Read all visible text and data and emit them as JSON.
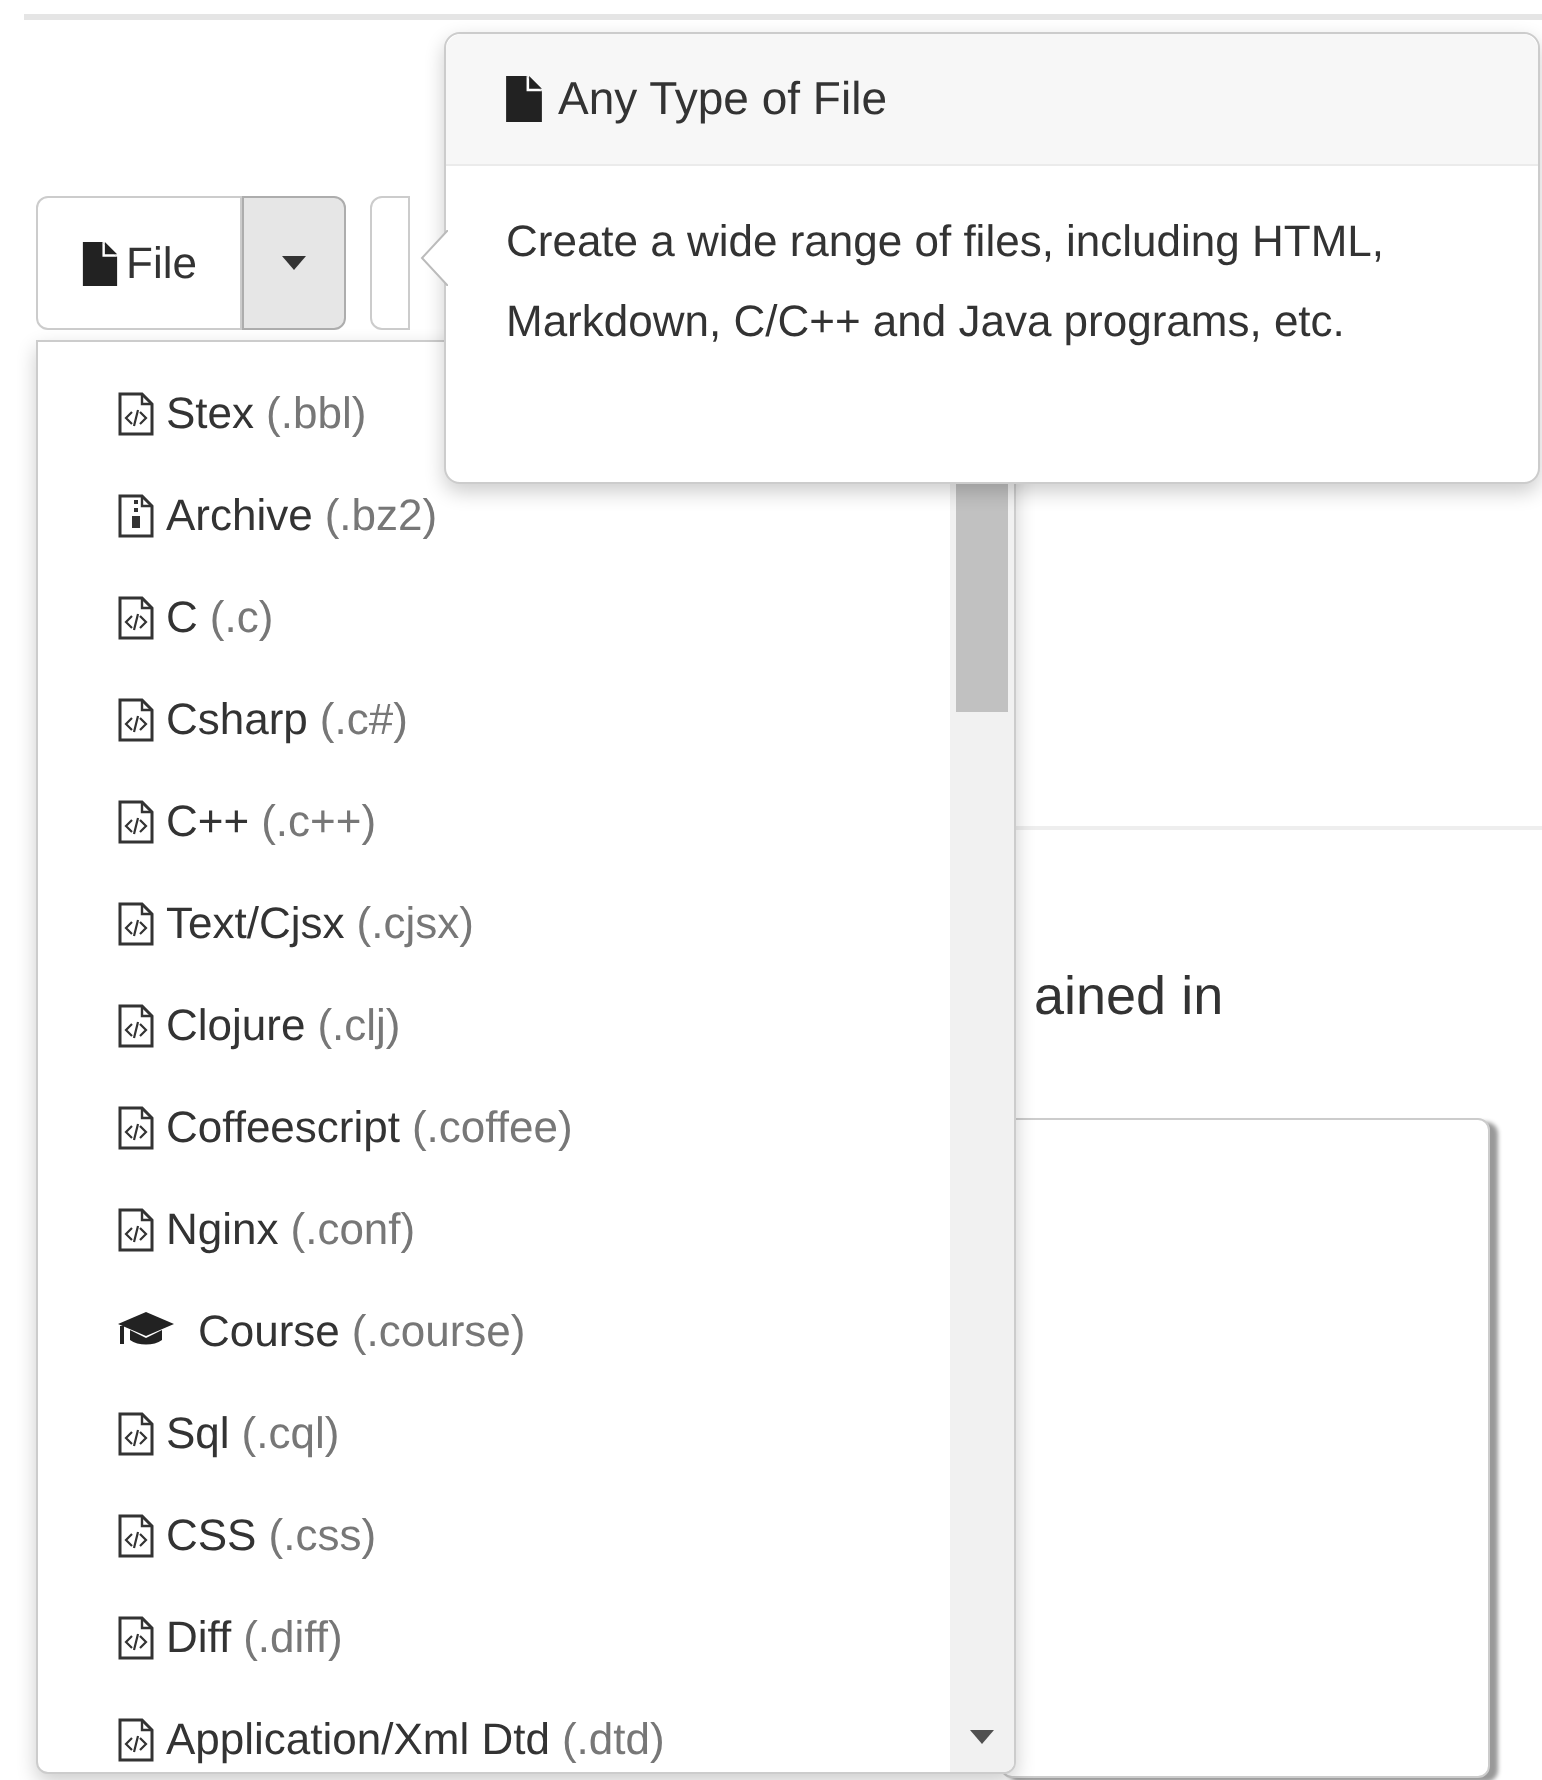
{
  "file_button": {
    "label": "File"
  },
  "popover": {
    "title": "Any Type of File",
    "body": "Create a wide range of files, including HTML, Markdown, C/C++ and Java programs, etc."
  },
  "background_text": "ained in",
  "menu": {
    "items": [
      {
        "kind": "code",
        "name": "Stex",
        "extension": "(.bbl)"
      },
      {
        "kind": "archive",
        "name": "Archive",
        "extension": "(.bz2)"
      },
      {
        "kind": "code",
        "name": "C",
        "extension": "(.c)"
      },
      {
        "kind": "code",
        "name": "Csharp",
        "extension": "(.c#)"
      },
      {
        "kind": "code",
        "name": "C++",
        "extension": "(.c++)"
      },
      {
        "kind": "code",
        "name": "Text/Cjsx",
        "extension": "(.cjsx)"
      },
      {
        "kind": "code",
        "name": "Clojure",
        "extension": "(.clj)"
      },
      {
        "kind": "code",
        "name": "Coffeescript",
        "extension": "(.coffee)"
      },
      {
        "kind": "code",
        "name": "Nginx",
        "extension": "(.conf)"
      },
      {
        "kind": "course",
        "name": "Course",
        "extension": "(.course)"
      },
      {
        "kind": "code",
        "name": "Sql",
        "extension": "(.cql)"
      },
      {
        "kind": "code",
        "name": "CSS",
        "extension": "(.css)"
      },
      {
        "kind": "code",
        "name": "Diff",
        "extension": "(.diff)"
      },
      {
        "kind": "code",
        "name": "Application/Xml Dtd",
        "extension": "(.dtd)"
      }
    ]
  }
}
